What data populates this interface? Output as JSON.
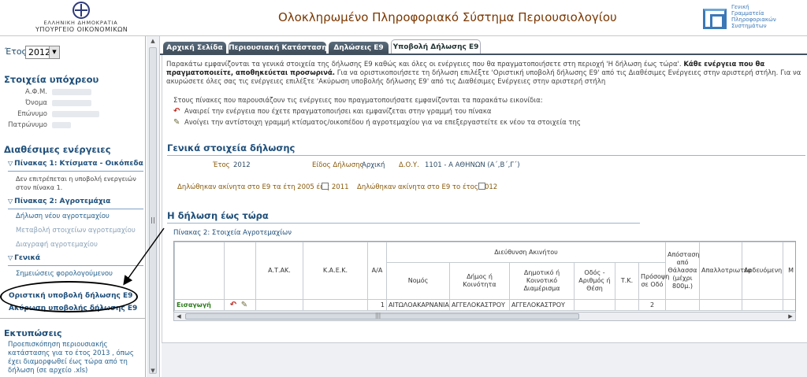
{
  "header": {
    "gov_line1": "ΕΛΛΗΝΙΚΗ ΔΗΜΟΚΡΑΤΙΑ",
    "gov_line2": "ΥΠΟΥΡΓΕΙΟ ΟΙΚΟΝΟΜΙΚΩΝ",
    "title": "Ολοκληρωμένο Πληροφοριακό Σύστημα Περιουσιολογίου",
    "gsis_text": "Γενική\nΓραμματεία\nΠληροφοριακών\nΣυστημάτων"
  },
  "left": {
    "year_label": "Έτος",
    "year_value": "2012",
    "taxpayer_title": "Στοιχεία υπόχρεου",
    "afm_label": "Α.Φ.Μ.",
    "name_label": "Όνομα",
    "surname_label": "Επώνυμο",
    "father_label": "Πατρώνυμο",
    "actions_title": "Διαθέσιμες ενέργειες",
    "group1": "Πίνακας 1: Κτίσματα - Οικόπεδα",
    "group1_note": "Δεν επιτρέπεται η υποβολή ενεργειών στον πίνακα 1.",
    "group2": "Πίνακας 2: Αγροτεμάχια",
    "group2_link1": "Δήλωση νέου αγροτεμαχίου",
    "group2_link2": "Μεταβολή στοιχείων αγροτεμαχίου",
    "group2_link3": "Διαγραφή αγροτεμαχίου",
    "group3": "Γενικά",
    "group3_link1": "Σημειώσεις φορολογούμενου",
    "final_submit": "Οριστική υποβολή δήλωσης Ε9",
    "cancel_submit": "Ακύρωση υποβολής δήλωσης Ε9",
    "print_title": "Εκτυπώσεις",
    "print_desc": "Προεπισκόπηση περιουσιακής κατάστασης για το έτος 2013 , όπως έχει διαμορφωθεί έως τώρα από τη δήλωση (σε αρχείο .xls)"
  },
  "tabs": [
    {
      "label": "Αρχική Σελίδα"
    },
    {
      "label": "Περιουσιακή Κατάσταση"
    },
    {
      "label": "Δηλώσεις Ε9"
    },
    {
      "label": "Υποβολή Δήλωσης Ε9"
    }
  ],
  "main": {
    "intro_p1": "Παρακάτω εμφανίζονται τα γενικά στοιχεία της δήλωσης Ε9 καθώς και όλες οι ενέργειες που θα πραγματοποιήσετε στη περιοχή 'Η δήλωση έως τώρα'.",
    "intro_bold": "Κάθε ενέργεια που θα πραγματοποιείτε, αποθηκεύεται προσωρινά.",
    "intro_p2": "Για να οριστικοποιήσετε τη δήλωση επιλέξτε 'Οριστική υποβολή δήλωσης Ε9' από τις Διαθέσιμες Ενέργειες στην αριστερή στήλη. Για να ακυρώσετε όλες σας τις ενέργειες επιλέξτε 'Ακύρωση υποβολής δήλωσης Ε9' από τις Διαθέσιμες Ενέργειες στην αριστερή στήλη",
    "legend_head": "Στους πίνακες που παρουσιάζουν τις ενέργειες που πραγματοποιήσατε εμφανίζονται τα παρακάτω εικονίδια:",
    "legend_undo": "Αναιρεί την ενέργεια που έχετε πραγματοποιήσει και εμφανίζεται στην γραμμή του πίνακα",
    "legend_edit": "Ανοίγει την αντίστοιχη γραμμή κτίσματος/οικοπέδου ή αγροτεμαχίου για να επεξεργαστείτε εκ νέου τα στοιχεία της",
    "general_title": "Γενικά στοιχεία δήλωσης",
    "year_label": "Έτος",
    "year_value": "2012",
    "kind_label": "Είδος Δήλωσης",
    "kind_value": "Αρχική",
    "doy_label": "Δ.Ο.Υ.",
    "doy_value": "1101 - Α ΑΘΗΝΩΝ (Α΄,Β΄,Γ΄)",
    "chk1_label": "Δηλώθηκαν ακίνητα στο Ε9 τα έτη 2005 έως 2011",
    "chk2_label": "Δηλώθηκαν ακίνητα στο Ε9 το έτος 2012",
    "sofar_title": "Η δήλωση έως τώρα",
    "table_caption": "Πίνακας 2: Στοιχεία Αγροτεμαχίων",
    "table": {
      "h_atak": "Α.Τ.ΑΚ.",
      "h_kaek": "Κ.Α.Ε.Κ.",
      "h_aa": "Α/Α",
      "h_address": "Διεύθυνση Ακινήτου",
      "h_nomos": "Νομός",
      "h_dimos": "Δήμος ή Κοινότητα",
      "h_diam": "Δημοτικό ή Κοινοτικό Διαμέρισμα",
      "h_odos": "Οδός - Αριθμός ή Θέση",
      "h_tk": "Τ.Κ.",
      "h_prosopsi": "Πρόσοψη σε Οδό",
      "h_apostasi": "Απόσταση από Θάλασσα (μέχρι 800μ.)",
      "h_apallotr": "Απαλλοτριωτέα",
      "h_ardevomeni": "Αρδευόμενη",
      "h_extra": "Μ Κ",
      "row": {
        "action": "Εισαγωγή",
        "aa": "1",
        "nomos": "ΑΙΤΩΛΟΑΚΑΡΝΑΝΙΑΣ",
        "dimos": "ΑΓΓΕΛΟΚΑΣΤΡΟΥ",
        "diam": "ΑΓΓΕΛΟΚΑΣΤΡΟΥ",
        "prosopsi": "2"
      }
    }
  },
  "icons": {
    "undo": "undo-arrow-icon",
    "edit": "edit-pencil-icon"
  },
  "colors": {
    "tab_dark": "#44525f",
    "heading_blue": "#1f4f7a",
    "title_brown": "#7a3700",
    "insert_green": "#2a7a1a"
  }
}
